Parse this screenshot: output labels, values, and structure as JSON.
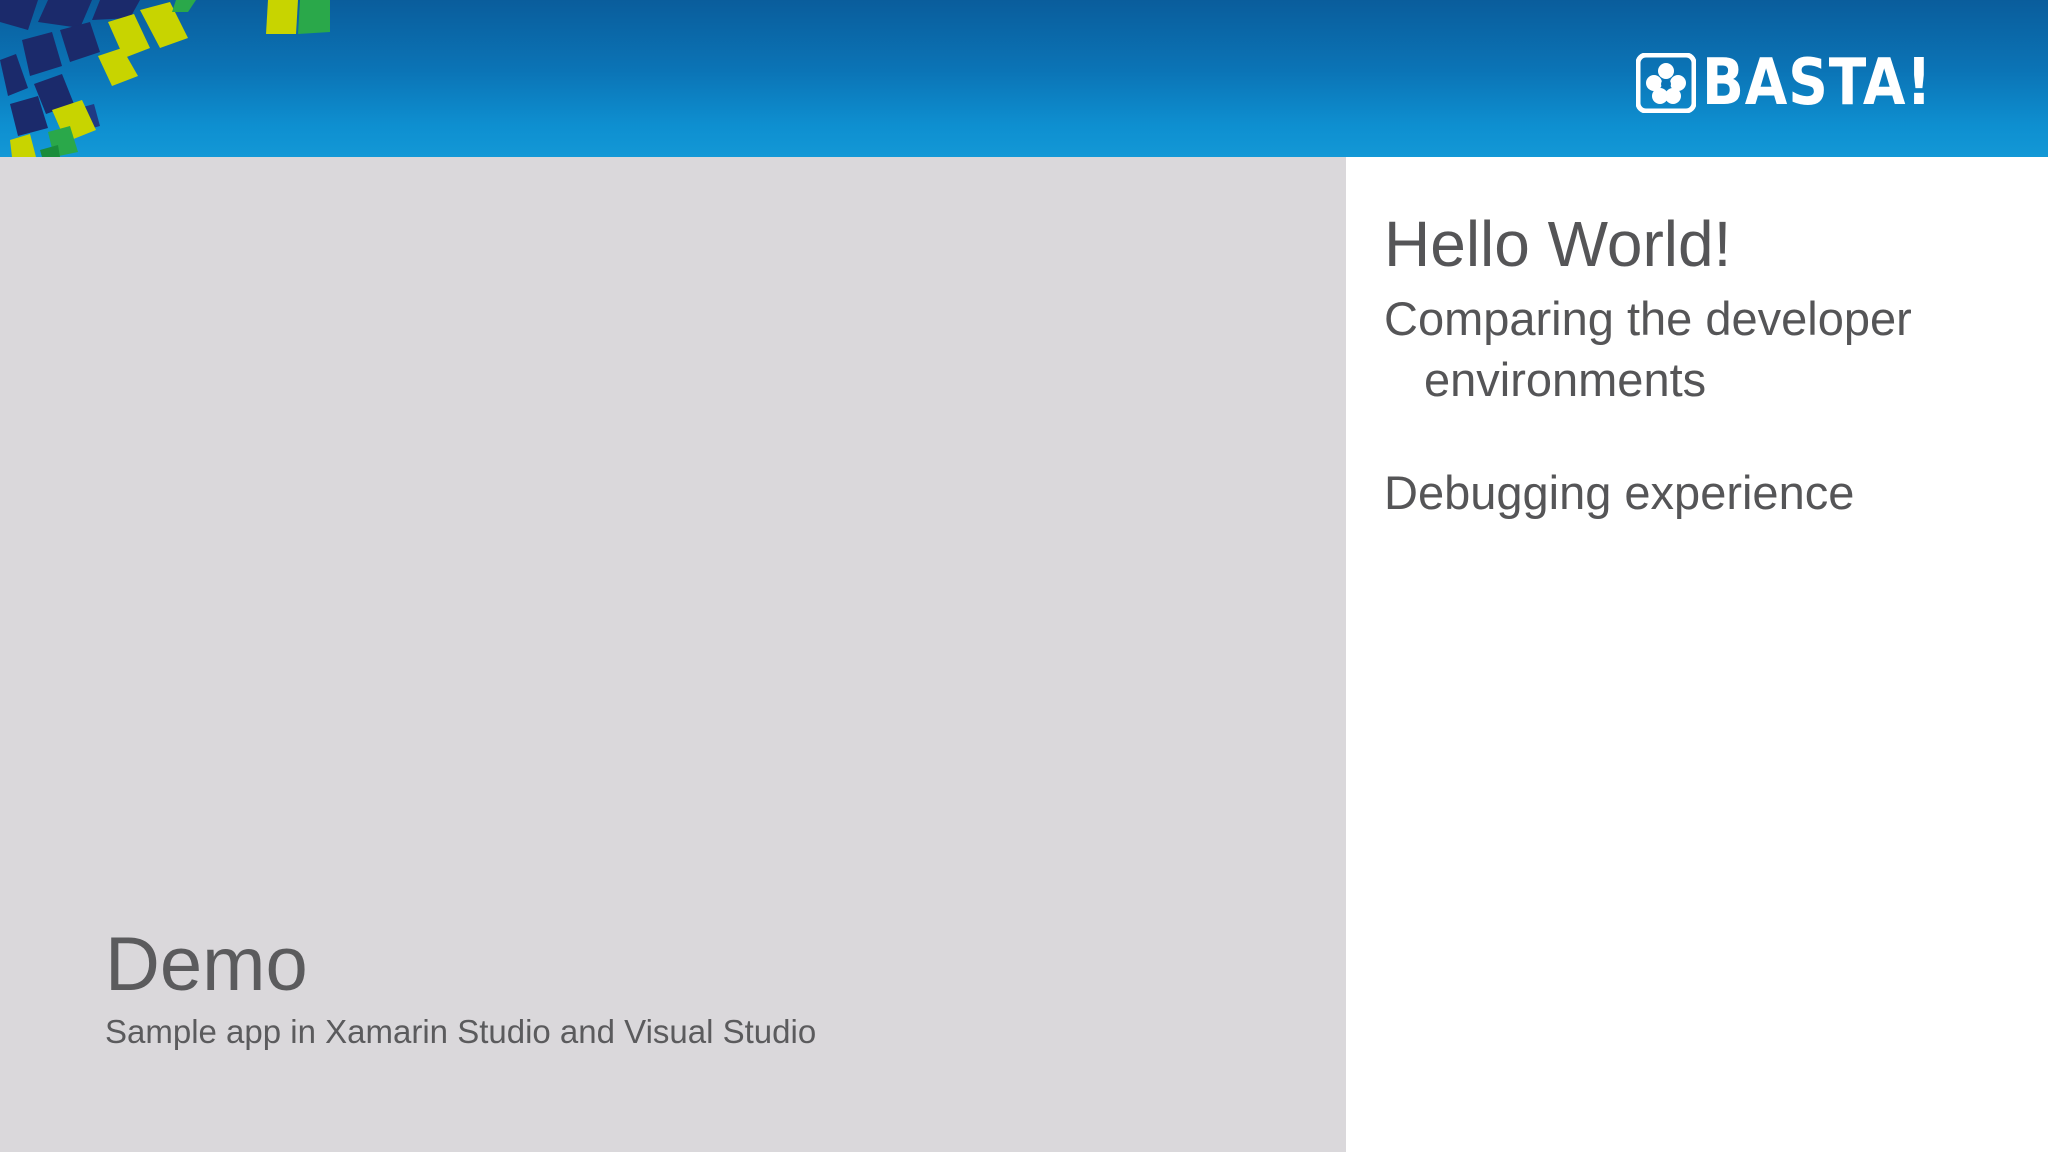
{
  "colors": {
    "header_top": "#0a5d9c",
    "header_bottom": "#1398d6",
    "left_panel_bg": "#dad8db",
    "text_gray": "#5b5b5d",
    "mosaic_navy": "#1b2a6b",
    "mosaic_lime": "#c8d400",
    "mosaic_green": "#2aa84a"
  },
  "header": {
    "logo_icon": "flower-logo-icon",
    "logo_text": "BASTA!"
  },
  "demo": {
    "title": "Demo",
    "subtitle": "Sample app in Xamarin Studio and Visual Studio"
  },
  "content": {
    "title": "Hello World!",
    "bullets": [
      "Comparing the developer environments",
      "Debugging experience"
    ]
  }
}
